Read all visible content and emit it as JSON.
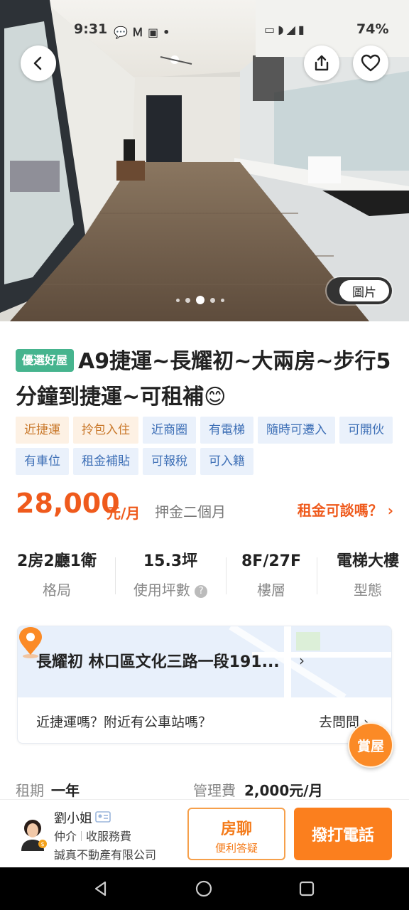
{
  "status_bar": {
    "time": "9:31",
    "battery": "74%",
    "notification_icons": [
      "speech-bubble-icon",
      "gmail-icon",
      "app-icon",
      "dot-icon"
    ],
    "system_icons": [
      "dot-icon",
      "cast-icon",
      "wifi-icon",
      "volte-icon",
      "signal-icon",
      "battery-icon"
    ]
  },
  "hero": {
    "photo_toggle_label": "圖片",
    "carousel_dots": 5,
    "active_dot": 2
  },
  "listing": {
    "badge": "優選好屋",
    "title": "A9捷運~長耀初~大兩房~步行5分鐘到捷運~可租補😊",
    "tags": [
      {
        "label": "近捷運",
        "style": "orange"
      },
      {
        "label": "拎包入住",
        "style": "orange"
      },
      {
        "label": "近商圈",
        "style": "blue"
      },
      {
        "label": "有電梯",
        "style": "blue"
      },
      {
        "label": "隨時可遷入",
        "style": "blue"
      },
      {
        "label": "可開伙",
        "style": "blue"
      },
      {
        "label": "有車位",
        "style": "blue"
      },
      {
        "label": "租金補貼",
        "style": "blue"
      },
      {
        "label": "可報稅",
        "style": "blue"
      },
      {
        "label": "可入籍",
        "style": "blue"
      }
    ],
    "price": "28,000",
    "price_unit": "元/月",
    "deposit": "押金二個月",
    "negotiate_link": "租金可談嗎？",
    "facts": [
      {
        "value": "2房2廳1衛",
        "label": "格局"
      },
      {
        "value": "15.3坪",
        "label": "使用坪數"
      },
      {
        "value": "8F/27F",
        "label": "樓層"
      },
      {
        "value": "電梯大樓",
        "label": "型態"
      }
    ],
    "address": "長耀初 林口區文化三路一段191...",
    "transit_question": "近捷運嗎？附近有公車站嗎？",
    "go_ask": "去問問",
    "fab_label": "賞屋",
    "lease_term_label": "租期",
    "lease_term_value": "一年",
    "management_fee_label": "管理費",
    "management_fee_value": "2,000元/月"
  },
  "agent": {
    "name": "劉小姐",
    "role": "仲介",
    "fee": "收服務費",
    "company": "誠真不動產有限公司",
    "chat_label": "房聊",
    "chat_sub": "便利答疑",
    "call_label": "撥打電話"
  },
  "colors": {
    "accent_orange": "#ef5a1c",
    "badge_green": "#46b48e",
    "call_button": "#fb7f1e"
  }
}
